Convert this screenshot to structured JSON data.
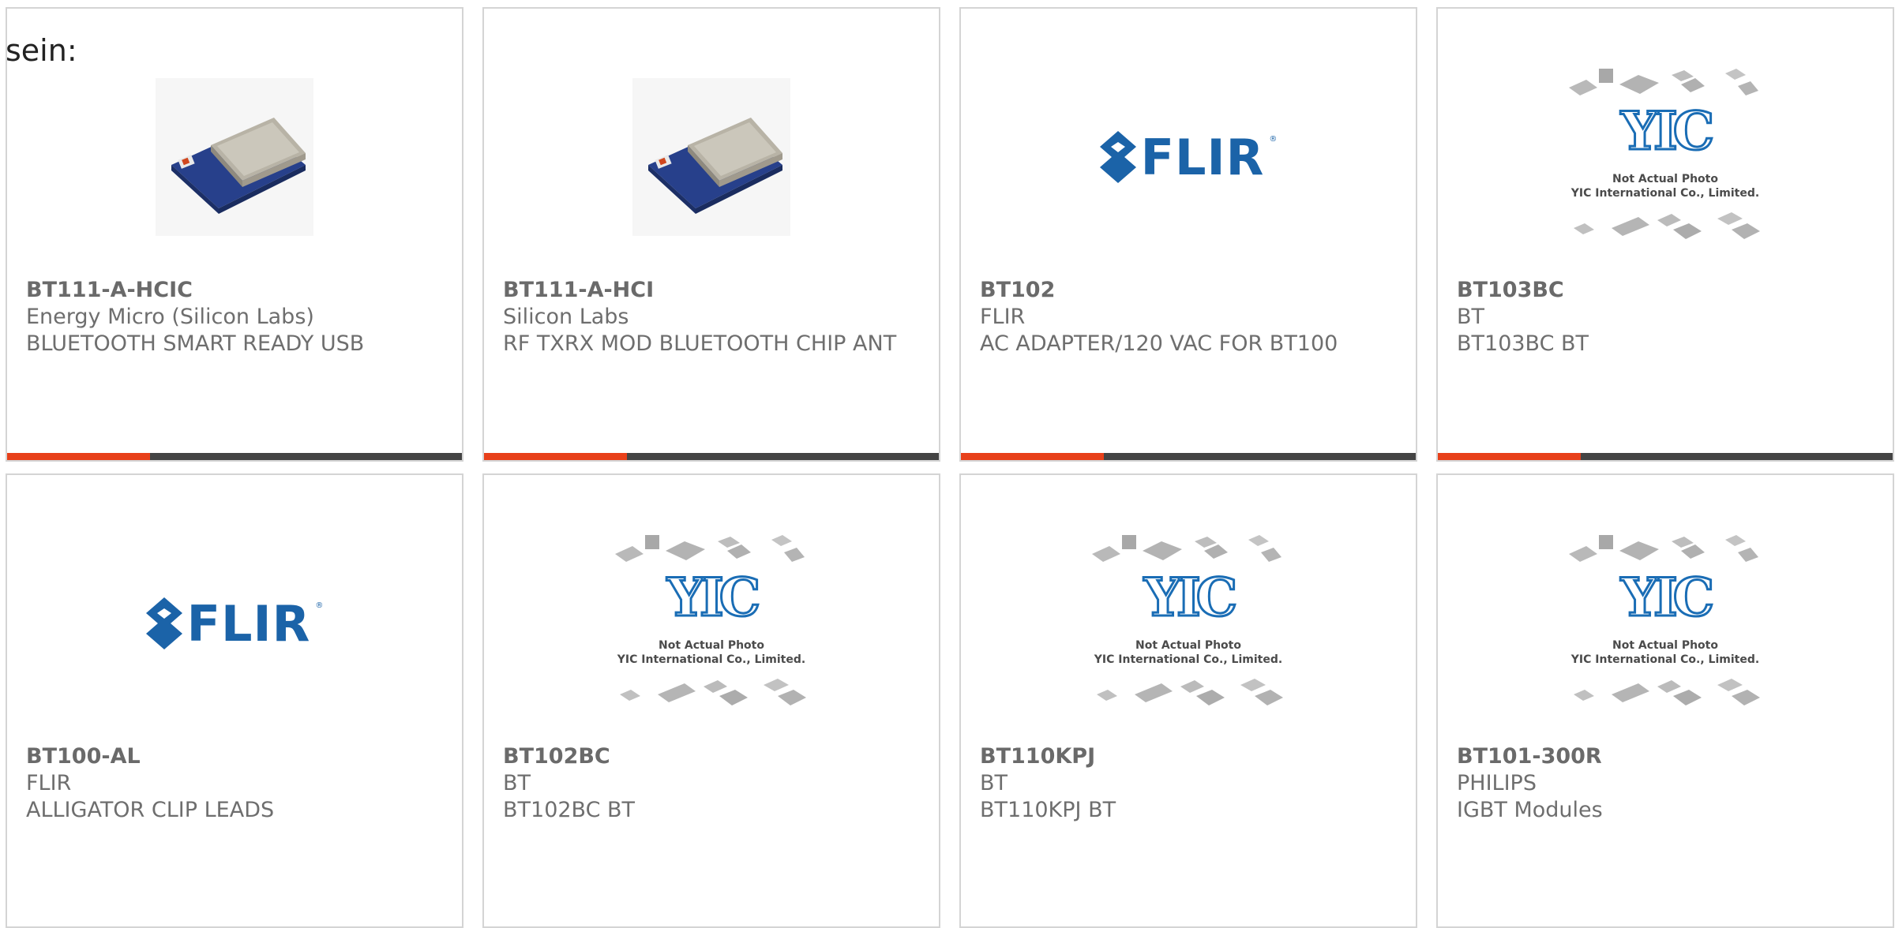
{
  "intro_text": "sein:",
  "colors": {
    "accent": "#e8401a",
    "bar": "#444444",
    "flir_blue": "#1b63a8",
    "yic_blue": "#1a6db5"
  },
  "placeholder": {
    "line1": "Not Actual Photo",
    "line2": "YIC International Co., Limited."
  },
  "flir_logo_text": "FLIR",
  "products": [
    {
      "part": "BT111-A-HCIC",
      "maker": "Energy Micro (Silicon Labs)",
      "desc": "BLUETOOTH SMART READY USB",
      "image": "bluetooth-module-photo"
    },
    {
      "part": "BT111-A-HCI",
      "maker": "Silicon Labs",
      "desc": "RF TXRX MOD BLUETOOTH CHIP ANT",
      "image": "bluetooth-module-photo"
    },
    {
      "part": "BT102",
      "maker": "FLIR",
      "desc": "AC ADAPTER/120 VAC FOR BT100",
      "image": "flir-logo"
    },
    {
      "part": "BT103BC",
      "maker": "BT",
      "desc": "BT103BC BT",
      "image": "yic-placeholder"
    },
    {
      "part": "BT100-AL",
      "maker": "FLIR",
      "desc": "ALLIGATOR CLIP LEADS",
      "image": "flir-logo"
    },
    {
      "part": "BT102BC",
      "maker": "BT",
      "desc": "BT102BC BT",
      "image": "yic-placeholder"
    },
    {
      "part": "BT110KPJ",
      "maker": "BT",
      "desc": "BT110KPJ BT",
      "image": "yic-placeholder"
    },
    {
      "part": "BT101-300R",
      "maker": "PHILIPS",
      "desc": "IGBT Modules",
      "image": "yic-placeholder"
    }
  ]
}
